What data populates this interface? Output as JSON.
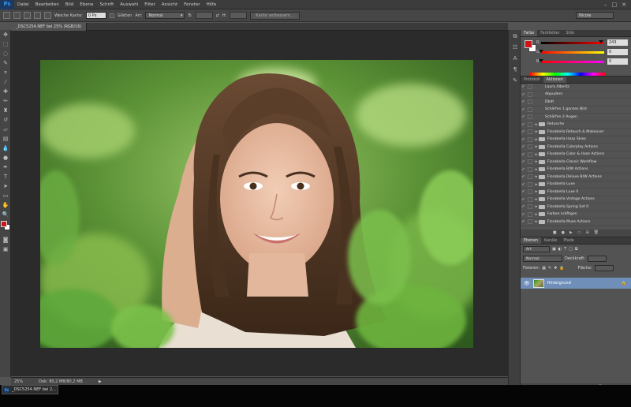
{
  "app": {
    "logo": "Ps"
  },
  "menubar": {
    "items": [
      "Datei",
      "Bearbeiten",
      "Bild",
      "Ebene",
      "Schrift",
      "Auswahl",
      "Filter",
      "Ansicht",
      "Fenster",
      "Hilfe"
    ],
    "window_controls": [
      "–",
      "□",
      "✕"
    ]
  },
  "options": {
    "soft_edge_label": "Weiche Kante:",
    "soft_edge_value": "0 Px",
    "smooth_label": "Glätten",
    "style_label": "Art:",
    "style_value": "Normal",
    "width_label": "B:",
    "height_label": "H:",
    "refine_button": "Kante verbessern...",
    "workspace": "Nicole"
  },
  "document": {
    "tab_title": "_DSC5254.NEF bei 25% (RGB/16)",
    "zoom": "25%",
    "doc_info": "Dok: 80,2 MB/80,2 MB"
  },
  "taskbar": {
    "item": "_DSC5254.NEF bei 2..."
  },
  "color_panel": {
    "tabs": [
      "Farbe",
      "Farbfelder",
      "Stile"
    ],
    "active_tab": "Farbe",
    "channels": [
      {
        "label": "R",
        "value": "243",
        "fraction": 0.95
      },
      {
        "label": "G",
        "value": "0",
        "fraction": 0.0
      },
      {
        "label": "B",
        "value": "0",
        "fraction": 0.0
      }
    ],
    "foreground_color": "#d01414",
    "background_color": "#ffffff"
  },
  "actions_panel": {
    "tabs": [
      "Protokoll",
      "Aktionen"
    ],
    "active_tab": "Aktionen",
    "items": [
      {
        "label": "Laura Albertz",
        "type": "child"
      },
      {
        "label": "Abpudern",
        "type": "child"
      },
      {
        "label": "Dbdt",
        "type": "child"
      },
      {
        "label": "Schärfen 1 ganzes Bild",
        "type": "child"
      },
      {
        "label": "Schärfen 2 Augen",
        "type": "child"
      },
      {
        "label": "Retusche",
        "type": "set"
      },
      {
        "label": "Florabella Retouch & Makeover",
        "type": "set"
      },
      {
        "label": "Florabella Hazy Skies",
        "type": "set"
      },
      {
        "label": "Florabella Colorplay Actions",
        "type": "set"
      },
      {
        "label": "Florabella Color & Haze Actions",
        "type": "set"
      },
      {
        "label": "Florabella Classic Workflow",
        "type": "set"
      },
      {
        "label": "Florabella B/W Actions",
        "type": "set"
      },
      {
        "label": "Florabella Deluxe B/W Actions",
        "type": "set"
      },
      {
        "label": "Florabella Luxe",
        "type": "set"
      },
      {
        "label": "Florabella Luxe II",
        "type": "set"
      },
      {
        "label": "Florabella Vintage Actions",
        "type": "set"
      },
      {
        "label": "Florabella Spring Set II",
        "type": "set"
      },
      {
        "label": "Farben kräftigen",
        "type": "set"
      },
      {
        "label": "Florabella Muse Actions",
        "type": "set"
      }
    ]
  },
  "layers_panel": {
    "tabs": [
      "Ebenen",
      "Kanäle",
      "Pfade"
    ],
    "active_tab": "Ebenen",
    "kind_label": "Art",
    "blend_mode": "Normal",
    "opacity_label": "Deckkraft:",
    "fix_label": "Fixieren:",
    "fill_label": "Fläche:",
    "layer_name": "Hintergrund"
  }
}
